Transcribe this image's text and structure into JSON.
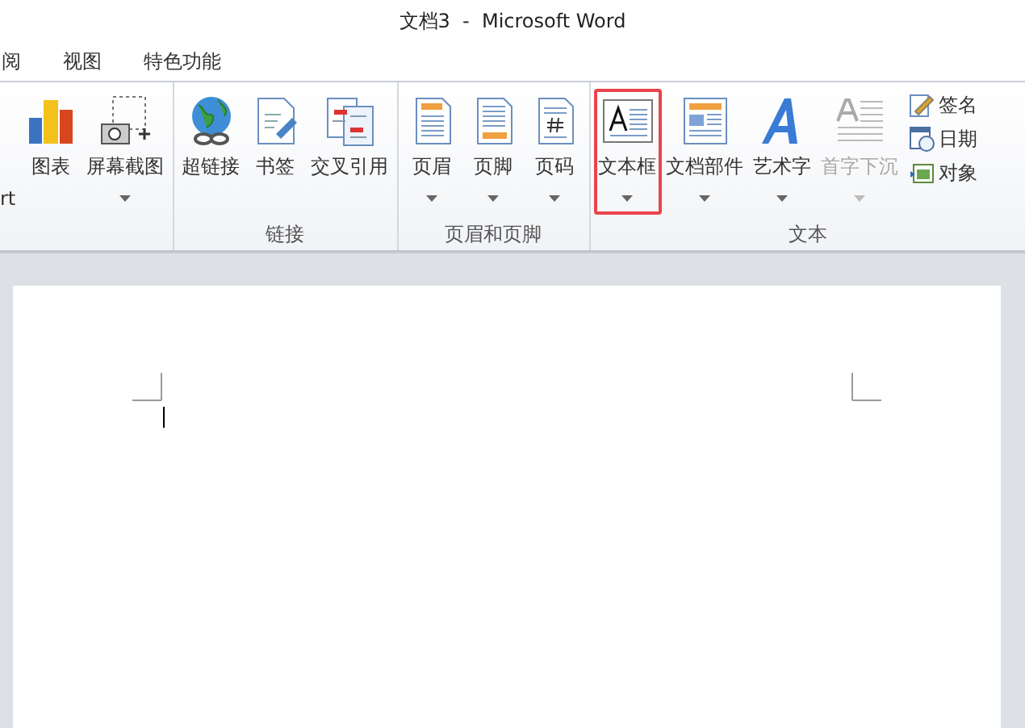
{
  "window": {
    "title": "文档3  -  Microsoft Word"
  },
  "tabs": [
    {
      "label": "阅",
      "selected": false
    },
    {
      "label": "视图",
      "selected": false
    },
    {
      "label": "特色功能",
      "selected": false
    }
  ],
  "ribbon": {
    "groups": [
      {
        "buttons": [
          {
            "kind": "large",
            "label": "rt",
            "dropdown": false,
            "highlighted": false,
            "disabled": false
          },
          {
            "kind": "large",
            "label": "图表",
            "dropdown": false,
            "highlighted": false,
            "disabled": false
          },
          {
            "kind": "large",
            "label": "屏幕截图",
            "dropdown": true,
            "highlighted": false,
            "disabled": false
          }
        ]
      },
      {
        "label": "链接",
        "buttons": [
          {
            "kind": "large",
            "label": "超链接",
            "dropdown": false,
            "highlighted": false,
            "disabled": false
          },
          {
            "kind": "large",
            "label": "书签",
            "dropdown": false,
            "highlighted": false,
            "disabled": false
          },
          {
            "kind": "large",
            "label": "交叉引用",
            "dropdown": false,
            "highlighted": false,
            "disabled": false
          }
        ]
      },
      {
        "label": "页眉和页脚",
        "buttons": [
          {
            "kind": "large",
            "label": "页眉",
            "dropdown": true,
            "highlighted": false,
            "disabled": false
          },
          {
            "kind": "large",
            "label": "页脚",
            "dropdown": true,
            "highlighted": false,
            "disabled": false
          },
          {
            "kind": "large",
            "label": "页码",
            "dropdown": true,
            "highlighted": false,
            "disabled": false
          }
        ]
      },
      {
        "label": "文本",
        "buttons": [
          {
            "kind": "large",
            "label": "文本框",
            "dropdown": true,
            "highlighted": true,
            "disabled": false
          },
          {
            "kind": "large",
            "label": "文档部件",
            "dropdown": true,
            "highlighted": false,
            "disabled": false
          },
          {
            "kind": "large",
            "label": "艺术字",
            "dropdown": true,
            "highlighted": false,
            "disabled": false
          },
          {
            "kind": "large",
            "label": "首字下沉",
            "dropdown": true,
            "highlighted": false,
            "disabled": true
          },
          {
            "kind": "small",
            "label": "签名"
          },
          {
            "kind": "small",
            "label": "日期"
          },
          {
            "kind": "small",
            "label": "对象"
          }
        ]
      }
    ]
  }
}
